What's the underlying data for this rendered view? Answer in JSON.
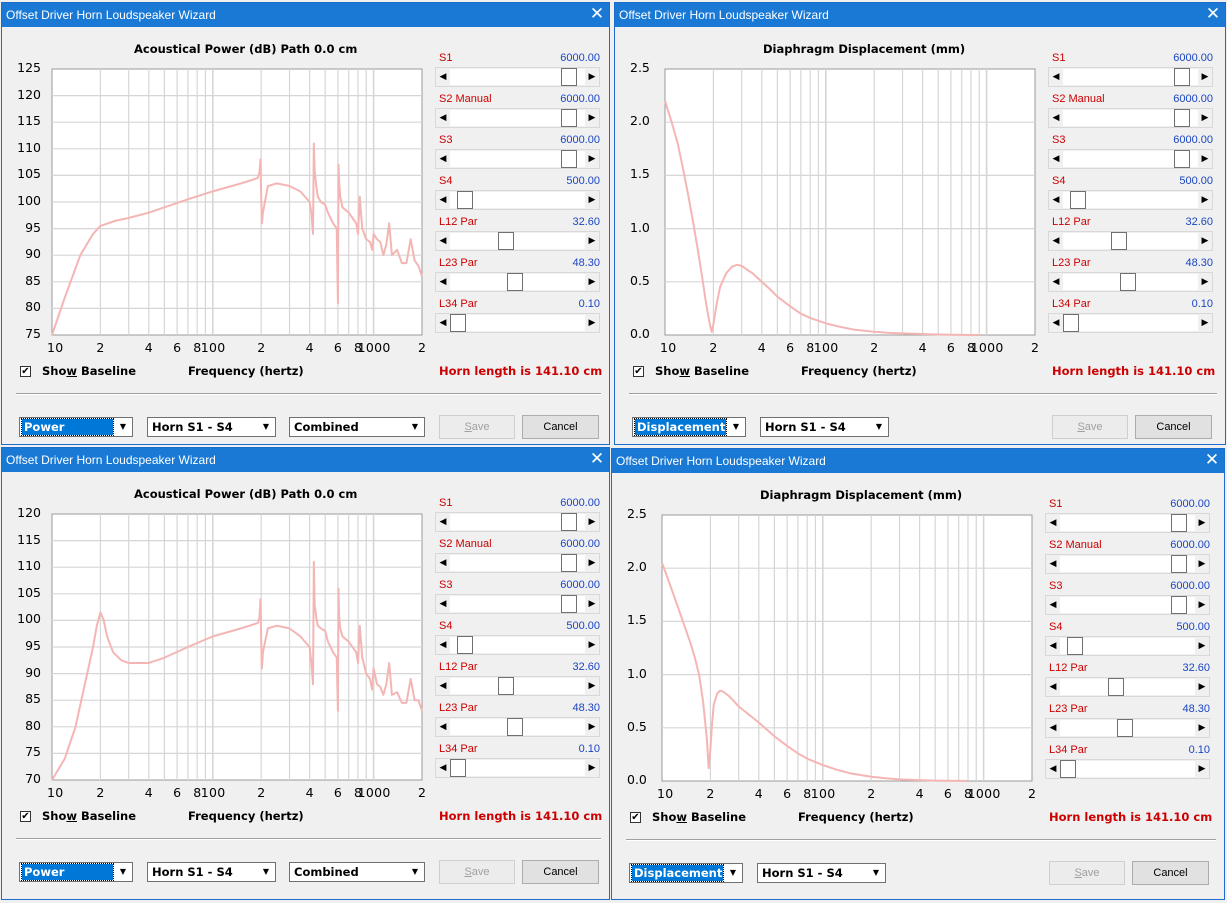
{
  "windows": [
    {
      "id": "w1",
      "title": "Offset Driver Horn Loudspeaker Wizard",
      "chart_title": "Acoustical Power (dB)   Path 0.0 cm",
      "view": "Power",
      "source": "Horn S1 - S4",
      "mode": "Combined",
      "curve_color": "#f4b6b4",
      "horn_length": "Horn length is 141.10 cm",
      "show_baseline": {
        "label": "Show Baseline",
        "checked": true
      },
      "xlabel": "Frequency (hertz)",
      "save_label": "Save",
      "cancel_label": "Cancel",
      "yticks": [
        "125",
        "120",
        "115",
        "110",
        "105",
        "100",
        "95",
        "90",
        "85",
        "80",
        "75"
      ],
      "xticks": [
        "10",
        "2",
        "4",
        "6",
        "8",
        "100",
        "2",
        "4",
        "6",
        "8",
        "1000",
        "2"
      ],
      "sliders": [
        {
          "label": "S1",
          "value": "6000.00",
          "pos": 0.92
        },
        {
          "label": "S2  Manual",
          "value": "6000.00",
          "pos": 0.92
        },
        {
          "label": "S3",
          "value": "6000.00",
          "pos": 0.92
        },
        {
          "label": "S4",
          "value": "500.00",
          "pos": 0.06
        },
        {
          "label": "L12  Par",
          "value": "32.60",
          "pos": 0.4
        },
        {
          "label": "L23  Par",
          "value": "48.30",
          "pos": 0.47
        },
        {
          "label": "L34  Par",
          "value": "0.10",
          "pos": 0.0
        }
      ],
      "chart_data": {
        "type": "line",
        "title": "Acoustical Power (dB)   Path 0.0 cm",
        "xlabel": "Frequency (hertz)",
        "ylabel": "",
        "xscale": "log",
        "xlim": [
          10,
          2000
        ],
        "ylim": [
          75,
          125
        ],
        "grid": true,
        "series": [
          {
            "x": [
              10,
              12,
              15,
              18,
              20,
              25,
              30,
              40,
              50,
              70,
              100,
              150,
              190,
              195,
              198,
              200,
              202,
              205,
              220,
              250,
              300,
              350,
              400,
              410,
              420,
              425,
              430,
              440,
              450,
              470,
              500,
              520,
              560,
              590,
              600,
              605,
              610,
              620,
              640,
              700,
              780,
              800,
              820,
              850,
              900,
              950,
              980,
              1000,
              1050,
              1100,
              1150,
              1200,
              1250,
              1300,
              1400,
              1500,
              1600,
              1700,
              1800,
              1900,
              2000
            ],
            "y": [
              75,
              82,
              90,
              94,
              95.5,
              96.5,
              97,
              98,
              99,
              100.5,
              102,
              103.5,
              104.5,
              105.5,
              108,
              101,
              96,
              98,
              103,
              103.5,
              103,
              102,
              100,
              98,
              94,
              111,
              106,
              103,
              101,
              100,
              99.5,
              98,
              96,
              95,
              81,
              107,
              104,
              101,
              99,
              98,
              96,
              94,
              101,
              95,
              93,
              92.5,
              91,
              94,
              93,
              92.5,
              90,
              92,
              96,
              90,
              91,
              88.5,
              88.5,
              93,
              89,
              88,
              86
            ]
          }
        ]
      }
    },
    {
      "id": "w2",
      "title": "Offset Driver Horn Loudspeaker Wizard",
      "chart_title": "Diaphragm Displacement (mm)",
      "view": "Displacement",
      "source": "Horn S1 - S4",
      "curve_color": "#f4b6b4",
      "horn_length": "Horn length is 141.10 cm",
      "show_baseline": {
        "label": "Show Baseline",
        "checked": true
      },
      "xlabel": "Frequency (hertz)",
      "save_label": "Save",
      "cancel_label": "Cancel",
      "yticks": [
        "2.5",
        "2.0",
        "1.5",
        "1.0",
        "0.5",
        "0.0"
      ],
      "xticks": [
        "10",
        "2",
        "4",
        "6",
        "8",
        "100",
        "2",
        "4",
        "6",
        "8",
        "1000",
        "2"
      ],
      "sliders": [
        {
          "label": "S1",
          "value": "6000.00",
          "pos": 0.92
        },
        {
          "label": "S2  Manual",
          "value": "6000.00",
          "pos": 0.92
        },
        {
          "label": "S3",
          "value": "6000.00",
          "pos": 0.92
        },
        {
          "label": "S4",
          "value": "500.00",
          "pos": 0.06
        },
        {
          "label": "L12  Par",
          "value": "32.60",
          "pos": 0.4
        },
        {
          "label": "L23  Par",
          "value": "48.30",
          "pos": 0.47
        },
        {
          "label": "L34  Par",
          "value": "0.10",
          "pos": 0.0
        }
      ],
      "chart_data": {
        "type": "line",
        "title": "Diaphragm Displacement (mm)",
        "xlabel": "Frequency (hertz)",
        "ylabel": "",
        "xscale": "log",
        "xlim": [
          10,
          2000
        ],
        "ylim": [
          0,
          2.5
        ],
        "grid": true,
        "series": [
          {
            "x": [
              10,
              11,
              12,
              13,
              14,
              15,
              16,
              17,
              18,
              19,
              19.5,
              20,
              21,
              22,
              24,
              26,
              28,
              30,
              32,
              35,
              40,
              45,
              50,
              60,
              70,
              80,
              100,
              120,
              150,
              200,
              250,
              300,
              400,
              500,
              600,
              700,
              800,
              900
            ],
            "y": [
              2.2,
              2.0,
              1.8,
              1.55,
              1.3,
              1.05,
              0.8,
              0.55,
              0.3,
              0.1,
              0.03,
              0.1,
              0.3,
              0.45,
              0.58,
              0.64,
              0.66,
              0.65,
              0.62,
              0.58,
              0.5,
              0.43,
              0.36,
              0.27,
              0.2,
              0.16,
              0.11,
              0.08,
              0.05,
              0.03,
              0.02,
              0.015,
              0.01,
              0.005,
              0.002,
              0.001,
              0.0,
              0.0
            ]
          }
        ]
      }
    },
    {
      "id": "w3",
      "title": "Offset Driver Horn Loudspeaker Wizard",
      "chart_title": "Acoustical Power (dB)   Path 0.0 cm",
      "view": "Power",
      "source": "Horn S1 - S4",
      "mode": "Combined",
      "curve_color": "#f4b6b4",
      "horn_length": "Horn length is 141.10 cm",
      "show_baseline": {
        "label": "Show Baseline",
        "checked": true
      },
      "xlabel": "Frequency (hertz)",
      "save_label": "Save",
      "cancel_label": "Cancel",
      "yticks": [
        "120",
        "115",
        "110",
        "105",
        "100",
        "95",
        "90",
        "85",
        "80",
        "75",
        "70"
      ],
      "xticks": [
        "10",
        "2",
        "4",
        "6",
        "8",
        "100",
        "2",
        "4",
        "6",
        "8",
        "1000",
        "2"
      ],
      "sliders": [
        {
          "label": "S1",
          "value": "6000.00",
          "pos": 0.92
        },
        {
          "label": "S2  Manual",
          "value": "6000.00",
          "pos": 0.92
        },
        {
          "label": "S3",
          "value": "6000.00",
          "pos": 0.92
        },
        {
          "label": "S4",
          "value": "500.00",
          "pos": 0.06
        },
        {
          "label": "L12  Par",
          "value": "32.60",
          "pos": 0.4
        },
        {
          "label": "L23  Par",
          "value": "48.30",
          "pos": 0.47
        },
        {
          "label": "L34  Par",
          "value": "0.10",
          "pos": 0.0
        }
      ],
      "chart_data": {
        "type": "line",
        "title": "Acoustical Power (dB)   Path 0.0 cm",
        "xlabel": "Frequency (hertz)",
        "ylabel": "",
        "xscale": "log",
        "xlim": [
          10,
          2000
        ],
        "ylim": [
          70,
          120
        ],
        "grid": true,
        "series": [
          {
            "x": [
              10,
              12,
              14,
              16,
              18,
              19,
              20,
              21,
              22,
              24,
              27,
              30,
              35,
              40,
              50,
              70,
              100,
              150,
              190,
              195,
              198,
              200,
              202,
              205,
              220,
              250,
              300,
              350,
              400,
              410,
              420,
              425,
              430,
              440,
              450,
              470,
              500,
              520,
              560,
              590,
              600,
              605,
              610,
              620,
              640,
              700,
              780,
              800,
              820,
              850,
              900,
              950,
              980,
              1000,
              1050,
              1100,
              1150,
              1200,
              1250,
              1300,
              1400,
              1500,
              1600,
              1700,
              1800,
              1900,
              2000
            ],
            "y": [
              70,
              74,
              80,
              88,
              95,
              99,
              101.5,
              100,
              97,
              94,
              92.5,
              92,
              92,
              92,
              93,
              95,
              97,
              98.5,
              99.5,
              100.5,
              104,
              96,
              91,
              94,
              98.5,
              99,
              98.5,
              97,
              95,
              92,
              88,
              111,
              103,
              100.5,
              99,
              98.5,
              98,
              96,
              94,
              93,
              83,
              106,
              101,
              98.5,
              97,
              96,
              94,
              92,
              99,
              93,
              90,
              89,
              87,
              91,
              88,
              87.5,
              86,
              88,
              92,
              86,
              86.5,
              84.5,
              84.5,
              89,
              85,
              85,
              83
            ]
          }
        ]
      }
    },
    {
      "id": "w4",
      "title": "Offset Driver Horn Loudspeaker Wizard",
      "chart_title": "Diaphragm Displacement (mm)",
      "view": "Displacement",
      "source": "Horn S1 - S4",
      "curve_color": "#f4b6b4",
      "horn_length": "Horn length is 141.10 cm",
      "show_baseline": {
        "label": "Show Baseline",
        "checked": true
      },
      "xlabel": "Frequency (hertz)",
      "save_label": "Save",
      "cancel_label": "Cancel",
      "yticks": [
        "2.5",
        "2.0",
        "1.5",
        "1.0",
        "0.5",
        "0.0"
      ],
      "xticks": [
        "10",
        "2",
        "4",
        "6",
        "8",
        "100",
        "2",
        "4",
        "6",
        "8",
        "1000",
        "2"
      ],
      "sliders": [
        {
          "label": "S1",
          "value": "6000.00",
          "pos": 0.92
        },
        {
          "label": "S2  Manual",
          "value": "6000.00",
          "pos": 0.92
        },
        {
          "label": "S3",
          "value": "6000.00",
          "pos": 0.92
        },
        {
          "label": "S4",
          "value": "500.00",
          "pos": 0.06
        },
        {
          "label": "L12  Par",
          "value": "32.60",
          "pos": 0.4
        },
        {
          "label": "L23  Par",
          "value": "48.30",
          "pos": 0.47
        },
        {
          "label": "L34  Par",
          "value": "0.10",
          "pos": 0.0
        }
      ],
      "chart_data": {
        "type": "line",
        "title": "Diaphragm Displacement (mm)",
        "xlabel": "Frequency (hertz)",
        "ylabel": "",
        "xscale": "log",
        "xlim": [
          10,
          2000
        ],
        "ylim": [
          0,
          2.5
        ],
        "grid": true,
        "series": [
          {
            "x": [
              10,
              11,
              12,
              13,
              14,
              15,
              16,
              17,
              18,
              19,
              19.5,
              20,
              20.5,
              21,
              22,
              23,
              24,
              26,
              28,
              30,
              35,
              40,
              50,
              60,
              70,
              80,
              100,
              120,
              150,
              200,
              250,
              300,
              400,
              500,
              600,
              700,
              800
            ],
            "y": [
              2.05,
              1.88,
              1.72,
              1.57,
              1.43,
              1.3,
              1.16,
              1.0,
              0.75,
              0.4,
              0.12,
              0.3,
              0.55,
              0.72,
              0.82,
              0.85,
              0.84,
              0.8,
              0.75,
              0.7,
              0.62,
              0.55,
              0.42,
              0.33,
              0.26,
              0.21,
              0.15,
              0.11,
              0.07,
              0.04,
              0.025,
              0.015,
              0.008,
              0.004,
              0.002,
              0.001,
              0.0
            ]
          }
        ]
      }
    }
  ]
}
